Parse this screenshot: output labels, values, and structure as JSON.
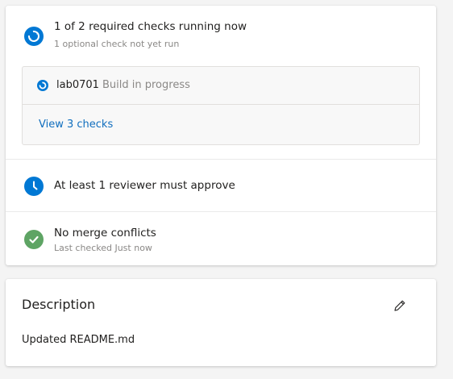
{
  "checks": {
    "summary": {
      "title": "1 of 2 required checks running now",
      "subtitle": "1 optional check not yet run",
      "icon": "in-progress-icon",
      "color": "#0078d4"
    },
    "build": {
      "name": "lab0701",
      "status": "Build in progress",
      "icon": "in-progress-icon",
      "color": "#0078d4"
    },
    "view_checks_label": "View 3 checks",
    "link_color": "#106ebe"
  },
  "reviewers": {
    "title": "At least 1 reviewer must approve",
    "icon": "clock-icon",
    "color": "#0078d4"
  },
  "merge": {
    "title": "No merge conflicts",
    "subtitle": "Last checked Just now",
    "icon": "check-icon",
    "color": "#5ea464"
  },
  "description": {
    "title": "Description",
    "body": "Updated README.md",
    "edit_icon": "pencil-icon"
  }
}
